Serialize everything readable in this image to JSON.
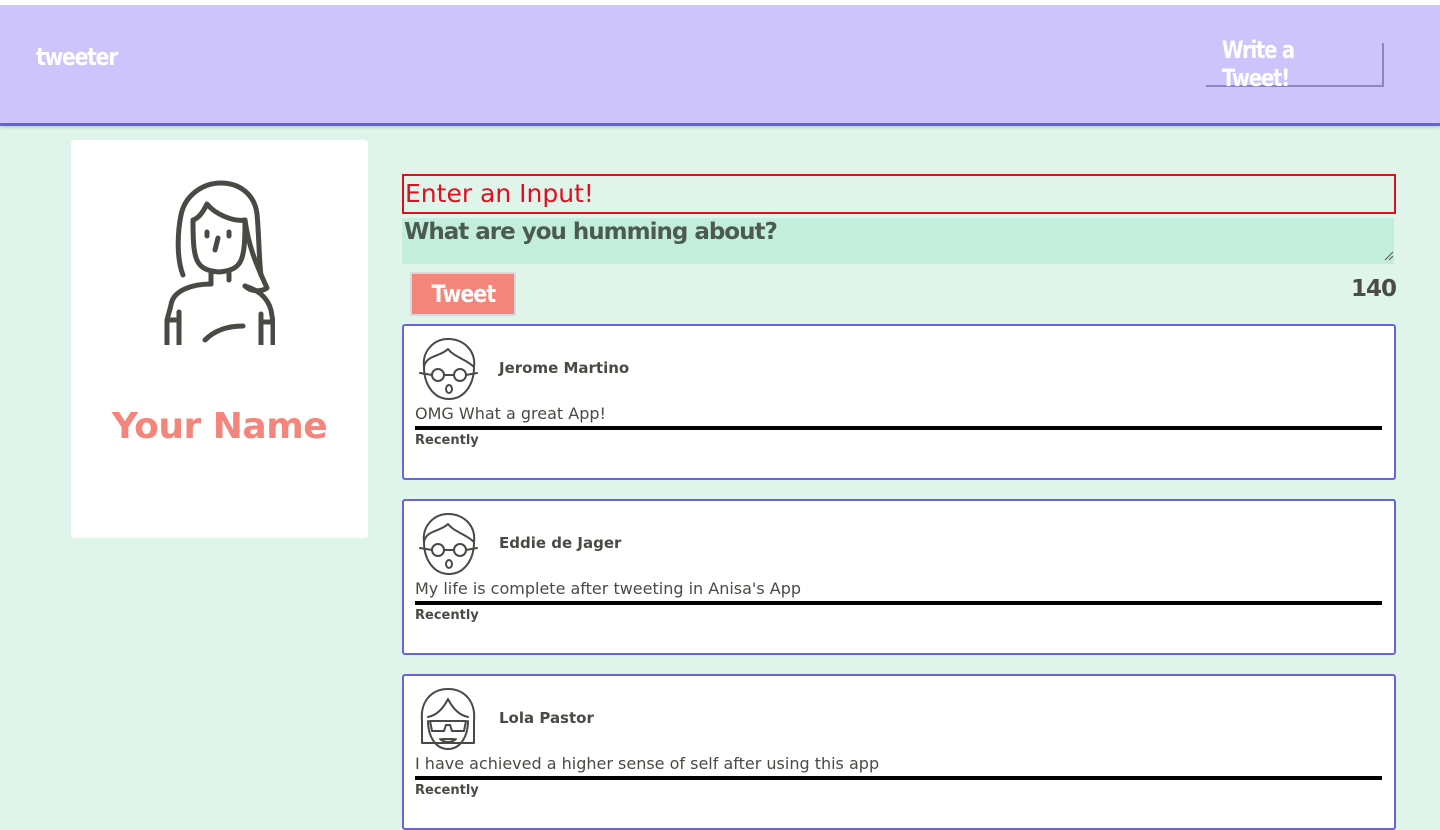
{
  "header": {
    "logo": "tweeter",
    "write_button": "Write a Tweet!"
  },
  "profile": {
    "avatar_icon": "woman-avatar-icon",
    "name": "Your Name"
  },
  "composer": {
    "error": "Enter an Input!",
    "placeholder": "What are you humming about?",
    "value": "",
    "tweet_button": "Tweet",
    "counter": "140"
  },
  "tweets": [
    {
      "author": "Jerome Martino",
      "text": "OMG What a great App!",
      "time": "Recently",
      "avatar_icon": "man-glasses-avatar-icon"
    },
    {
      "author": "Eddie de Jager",
      "text": "My life is complete after tweeting in Anisa's App",
      "time": "Recently",
      "avatar_icon": "man-glasses-avatar-icon"
    },
    {
      "author": "Lola Pastor",
      "text": "I have achieved a higher sense of self after using this app",
      "time": "Recently",
      "avatar_icon": "woman-sunglasses-avatar-icon"
    }
  ],
  "colors": {
    "page_bg": "#dff5ea",
    "header_bg": "#cdc4fb",
    "header_border": "#6a5fd8",
    "accent_salmon": "#f4857a",
    "error_red": "#e30d20",
    "card_border": "#6a63de",
    "input_bg": "#c3eedd"
  }
}
